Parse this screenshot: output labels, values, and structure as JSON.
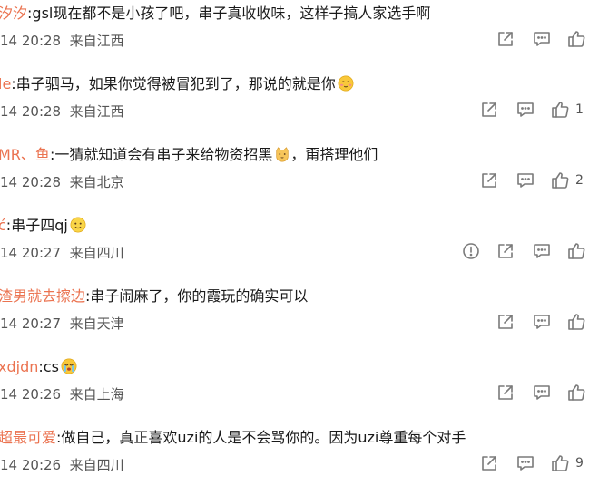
{
  "comments": [
    {
      "user": "汐汐",
      "text": ":gsl现在都不是小孩了吧，串子真收收味，这样子搞人家选手啊",
      "emoji": "",
      "time": "14 20:28",
      "location": "来自江西",
      "likes": ""
    },
    {
      "user": "le",
      "text": ":串子驷马，如果你觉得被冒犯到了，那说的就是你",
      "emoji": "blush-emoji",
      "time": "14 20:28",
      "location": "来自江西",
      "likes": "1"
    },
    {
      "user": "MR、鱼",
      "text": ":一猜就知道会有串子来给物资招黑",
      "emoji": "cat-emoji",
      "text2": "，甭搭理他们",
      "time": "14 20:28",
      "location": "来自北京",
      "likes": "2"
    },
    {
      "user": "ć",
      "text": ":串子四qj",
      "emoji": "smile-emoji",
      "time": "14 20:27",
      "location": "来自四川",
      "likes": ""
    },
    {
      "user": "渣男就去擦边",
      "text": ":串子闹麻了，你的霞玩的确实可以",
      "emoji": "",
      "time": "14 20:27",
      "location": "来自天津",
      "likes": ""
    },
    {
      "user": "xdjdn",
      "text": ":cs",
      "emoji": "cry-emoji",
      "time": "14 20:26",
      "location": "来自上海",
      "likes": ""
    },
    {
      "user": "超最可爱",
      "text": ":做自己，真正喜欢uzi的人是不会骂你的。因为uzi尊重每个对手",
      "emoji": "",
      "time": "14 20:26",
      "location": "来自四川",
      "likes": "9"
    }
  ],
  "colors": {
    "username": "#eb7350",
    "meta": "#555555",
    "icon": "#7a7a7a"
  }
}
